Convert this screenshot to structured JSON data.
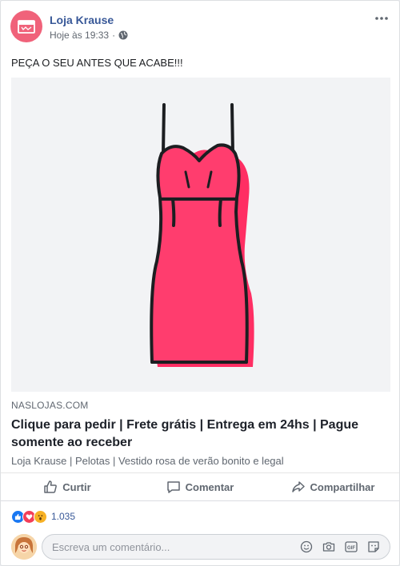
{
  "post": {
    "page_name": "Loja Krause",
    "timestamp": "Hoje às 19:33",
    "separator": "·",
    "privacy_icon": "globe-icon",
    "text": "PEÇA O SEU ANTES QUE ACABE!!!"
  },
  "link": {
    "domain": "NASLOJAS.COM",
    "title": "Clique para pedir | Frete grátis | Entrega em 24hs | Pague somente ao receber",
    "description": "Loja Krause | Pelotas | Vestido rosa de verão bonito e legal"
  },
  "actions": {
    "like": "Curtir",
    "comment": "Comentar",
    "share": "Compartilhar"
  },
  "reactions": {
    "icons": [
      "like-reaction-icon",
      "love-reaction-icon",
      "wow-reaction-icon"
    ],
    "count": "1.035"
  },
  "comment": {
    "placeholder": "Escreva um comentário..."
  },
  "colors": {
    "brand_link": "#385898",
    "dress_pink": "#ff2e63",
    "avatar_pink": "#f0627a"
  }
}
